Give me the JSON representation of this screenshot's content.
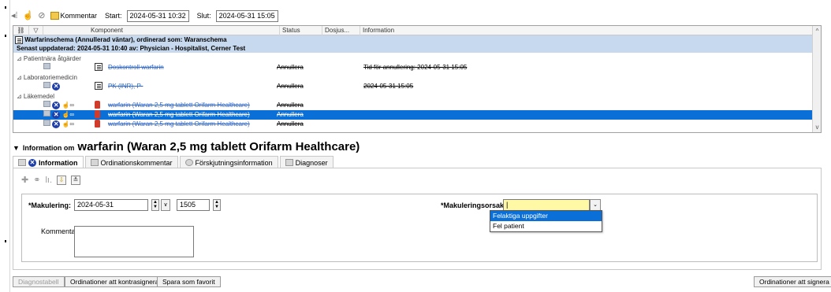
{
  "toolbar": {
    "comment_label": "Kommentar",
    "start_label": "Start:",
    "start_value": "2024-05-31 10:32",
    "end_label": "Slut:",
    "end_value": "2024-05-31 15:05"
  },
  "grid": {
    "columns": [
      "Komponent",
      "Status",
      "Dosjus...",
      "Information"
    ],
    "schema_title": "Warfarinschema (Annullerad väntar), ordinerad som: Waranschema",
    "schema_subtitle": "Senast uppdaterad: 2024-05-31 10:40   av: Physician - Hospitalist, Cerner Test",
    "groups": [
      {
        "name": "⊿ Patientnära åtgärder",
        "rows": [
          {
            "component": "Doskontroll warfarin",
            "status": "Annullera",
            "information": "Tid för annullering: 2024-05-31 15:05"
          }
        ]
      },
      {
        "name": "⊿ Laboratoriemedicin",
        "rows": [
          {
            "component": "PK (INR), P-",
            "status": "Annullera",
            "information": "2024-05-31 15:05"
          }
        ]
      },
      {
        "name": "⊿ Läkemedel",
        "rows": [
          {
            "component": "warfarin (Waran 2,5 mg tablett Orifarm Healthcare)",
            "status": "Annullera",
            "information": ""
          },
          {
            "component": "warfarin (Waran 2,5 mg tablett Orifarm Healthcare)",
            "status": "Annullera",
            "information": ""
          },
          {
            "component": "warfarin (Waran 2,5 mg tablett Orifarm Healthcare)",
            "status": "Annullera",
            "information": ""
          }
        ]
      }
    ]
  },
  "info_panel": {
    "prefix": "Information om",
    "title": "warfarin (Waran 2,5 mg tablett Orifarm Healthcare)",
    "tabs": [
      "Information",
      "Ordinationskommentar",
      "Förskjutningsinformation",
      "Diagnoser"
    ]
  },
  "form": {
    "makulering_label": "*Makulering:",
    "makulering_date": "2024-05-31",
    "makulering_time": "1505",
    "orsak_label": "*Makuleringsorsak:",
    "orsak_value": "|",
    "kommentar_label": "Kommentar:",
    "orsak_options": [
      "Felaktiga uppgifter",
      "Fel patient"
    ]
  },
  "bottom": {
    "diagnostabell": "Diagnostabell",
    "kontrasignera": "Ordinationer att kontrasignera",
    "favorit": "Spara som favorit",
    "signera": "Ordinationer att signera"
  },
  "colors": {
    "selection": "#0a6fd6",
    "group_header": "#c7d9ee",
    "link": "#2f66c8",
    "dropdown_field": "#fff9a6"
  }
}
